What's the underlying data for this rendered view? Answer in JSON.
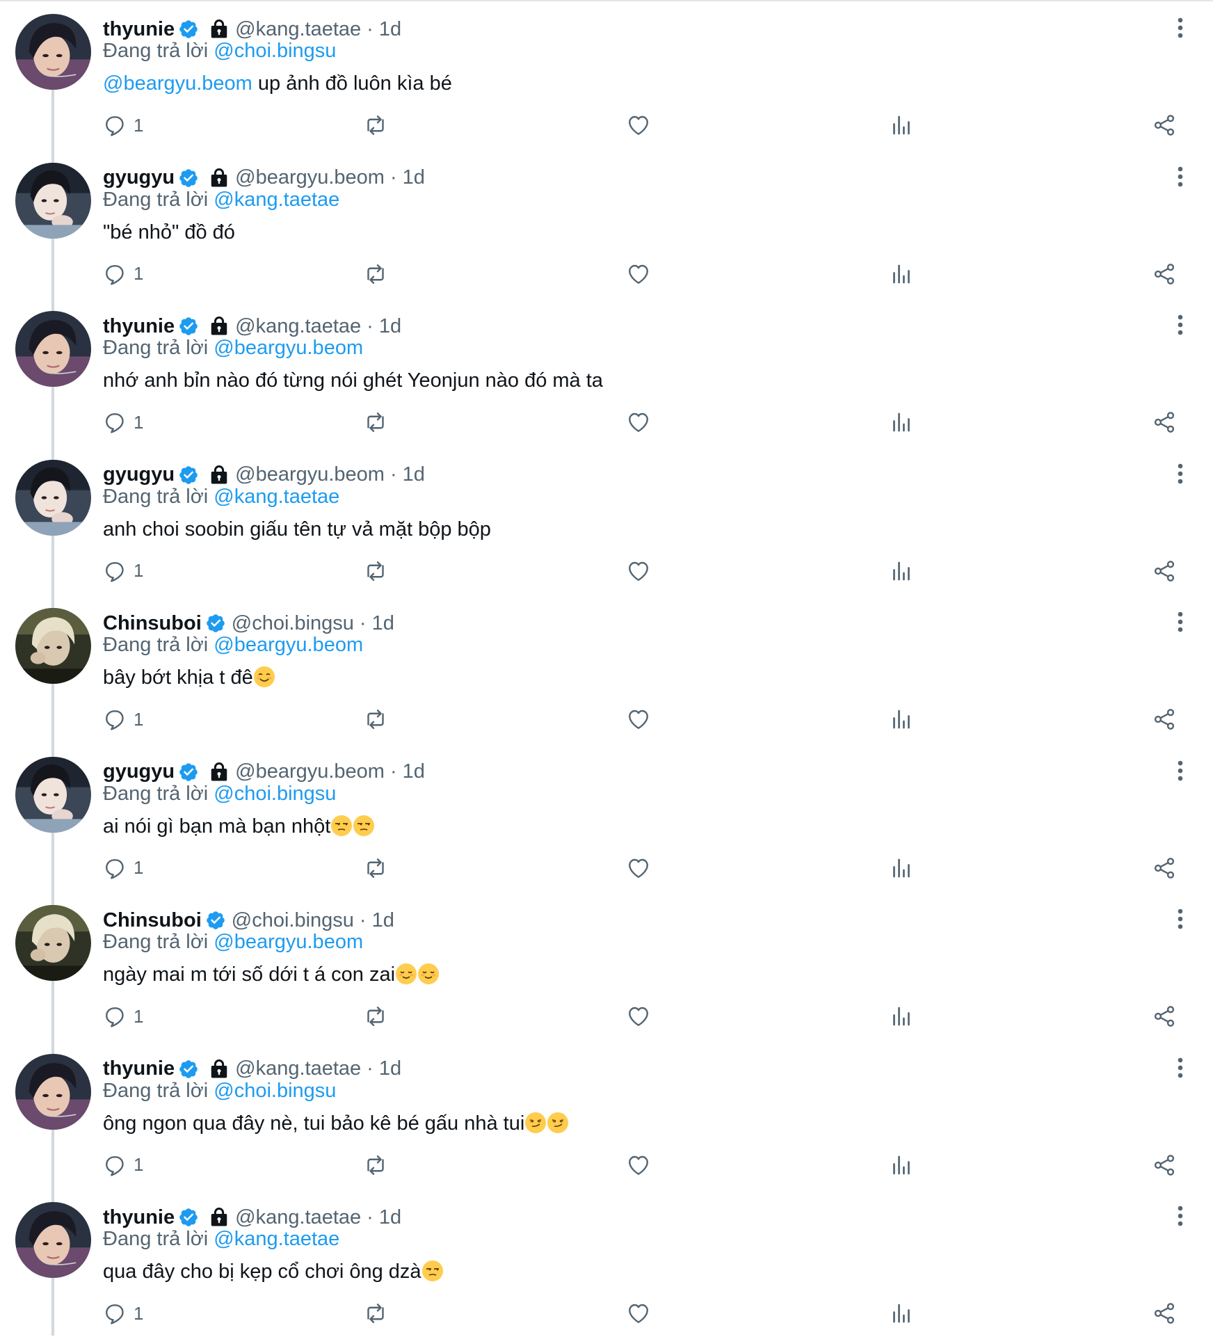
{
  "colors": {
    "accent": "#1d9bf0",
    "text": "#0f1419",
    "secondary_text": "#536471",
    "thread_line": "#cfd9de"
  },
  "tweets": [
    {
      "display_name": "thyunie",
      "handle": "@kang.taetae",
      "time": "1d",
      "verified": true,
      "protected": true,
      "replying_prefix": "Đang trả lời",
      "replying_to": "@choi.bingsu",
      "text_mention": "@beargyu.beom",
      "text": " up ảnh đồ luôn kìa bé",
      "emojis": [],
      "avatar": "thyunie-avatar",
      "reply_count": "1"
    },
    {
      "display_name": "gyugyu",
      "handle": "@beargyu.beom",
      "time": "1d",
      "verified": true,
      "protected": true,
      "replying_prefix": "Đang trả lời",
      "replying_to": "@kang.taetae",
      "text_mention": "",
      "text": "\"bé nhỏ\" đồ đó",
      "emojis": [],
      "avatar": "gyugyu-avatar",
      "reply_count": "1"
    },
    {
      "display_name": "thyunie",
      "handle": "@kang.taetae",
      "time": "1d",
      "verified": true,
      "protected": true,
      "replying_prefix": "Đang trả lời",
      "replying_to": "@beargyu.beom",
      "text_mention": "",
      "text": "nhớ anh bỉn nào đó từng nói ghét Yeonjun nào đó mà ta",
      "emojis": [],
      "avatar": "thyunie-avatar",
      "reply_count": "1"
    },
    {
      "display_name": "gyugyu",
      "handle": "@beargyu.beom",
      "time": "1d",
      "verified": true,
      "protected": true,
      "replying_prefix": "Đang trả lời",
      "replying_to": "@kang.taetae",
      "text_mention": "",
      "text": "anh choi soobin giấu tên tự vả mặt bộp bộp",
      "emojis": [],
      "avatar": "gyugyu-avatar",
      "reply_count": "1"
    },
    {
      "display_name": "Chinsuboi",
      "handle": "@choi.bingsu",
      "time": "1d",
      "verified": true,
      "protected": false,
      "replying_prefix": "Đang trả lời",
      "replying_to": "@beargyu.beom",
      "text_mention": "",
      "text": "bây bớt khịa t đê",
      "emojis": [
        "smiling-face-emoji"
      ],
      "avatar": "chinsuboi-avatar",
      "reply_count": "1"
    },
    {
      "display_name": "gyugyu",
      "handle": "@beargyu.beom",
      "time": "1d",
      "verified": true,
      "protected": true,
      "replying_prefix": "Đang trả lời",
      "replying_to": "@choi.bingsu",
      "text_mention": "",
      "text": "ai nói gì bạn mà bạn nhột",
      "emojis": [
        "unamused-face-emoji",
        "unamused-face-emoji"
      ],
      "avatar": "gyugyu-avatar",
      "reply_count": "1"
    },
    {
      "display_name": "Chinsuboi",
      "handle": "@choi.bingsu",
      "time": "1d",
      "verified": true,
      "protected": false,
      "replying_prefix": "Đang trả lời",
      "replying_to": "@beargyu.beom",
      "text_mention": "",
      "text": "ngày mai m tới số dới t á con zai",
      "emojis": [
        "relieved-face-emoji",
        "relieved-face-emoji"
      ],
      "avatar": "chinsuboi-avatar",
      "reply_count": "1"
    },
    {
      "display_name": "thyunie",
      "handle": "@kang.taetae",
      "time": "1d",
      "verified": true,
      "protected": true,
      "replying_prefix": "Đang trả lời",
      "replying_to": "@choi.bingsu",
      "text_mention": "",
      "text": "ông ngon qua đây nè, tui bảo kê bé gấu nhà tui",
      "emojis": [
        "smirking-face-emoji",
        "smirking-face-emoji"
      ],
      "avatar": "thyunie-avatar",
      "reply_count": "1"
    },
    {
      "display_name": "thyunie",
      "handle": "@kang.taetae",
      "time": "1d",
      "verified": true,
      "protected": true,
      "replying_prefix": "Đang trả lời",
      "replying_to": "@kang.taetae",
      "text_mention": "",
      "text": "qua đây cho bị kẹp cổ chơi ông dzà",
      "emojis": [
        "unamused-face-emoji"
      ],
      "avatar": "thyunie-avatar",
      "reply_count": "1"
    }
  ]
}
